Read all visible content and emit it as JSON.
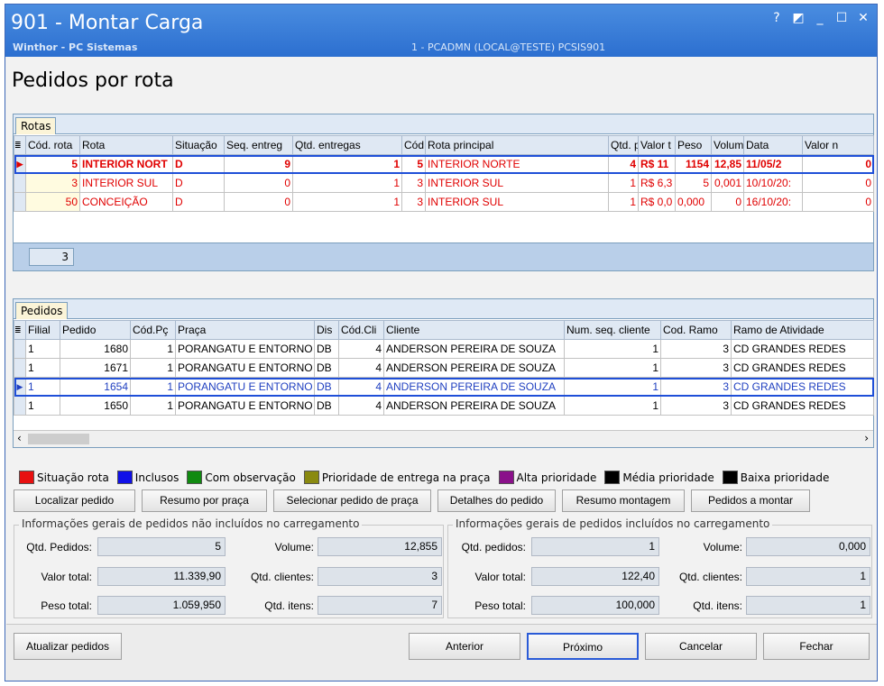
{
  "window": {
    "title": "901 - Montar Carga",
    "subtitle": "Winthor - PC Sistemas",
    "session": "1 - PCADMN (LOCAL@TESTE)   PCSIS901",
    "icons": [
      "help-icon",
      "restore-icon",
      "minimize-icon",
      "maximize-icon",
      "close-icon"
    ]
  },
  "page": {
    "heading": "Pedidos por rota"
  },
  "rotas": {
    "tab_label": "Rotas",
    "columns": [
      "Cód. rota",
      "Rota",
      "Situação",
      "Seq. entreg",
      "Qtd. entregas",
      "Cód",
      "Rota principal",
      "Qtd. p",
      "Valor t",
      "Peso",
      "Volume",
      "Data",
      "Valor n"
    ],
    "rows": [
      [
        "5",
        "INTERIOR NORT",
        "D",
        "9",
        "1",
        "5",
        "INTERIOR NORTE",
        "4",
        "R$ 11",
        "1154",
        "12,85",
        "11/05/2",
        "0"
      ],
      [
        "3",
        "INTERIOR SUL",
        "D",
        "0",
        "1",
        "3",
        "INTERIOR SUL",
        "1",
        "R$ 6,3",
        "5",
        "0,001",
        "10/10/20:",
        "0"
      ],
      [
        "50",
        "CONCEIÇÃO",
        "D",
        "0",
        "1",
        "3",
        "INTERIOR SUL",
        "1",
        "R$ 0,0",
        "0,000",
        "0",
        "16/10/20:",
        "0"
      ]
    ],
    "summary_count": "3"
  },
  "pedidos": {
    "tab_label": "Pedidos",
    "columns": [
      "Filial",
      "Pedido",
      "Cód.Pç",
      "Praça",
      "Dis",
      "Cód.Cli",
      "Cliente",
      "Num. seq. cliente",
      "Cod. Ramo",
      "Ramo de Atividade"
    ],
    "rows": [
      [
        "1",
        "1680",
        "1",
        "PORANGATU E ENTORNO",
        "DB",
        "4",
        "ANDERSON PEREIRA DE SOUZA",
        "1",
        "3",
        "CD GRANDES REDES"
      ],
      [
        "1",
        "1671",
        "1",
        "PORANGATU E ENTORNO",
        "DB",
        "4",
        "ANDERSON PEREIRA DE SOUZA",
        "1",
        "3",
        "CD GRANDES REDES"
      ],
      [
        "1",
        "1654",
        "1",
        "PORANGATU E ENTORNO",
        "DB",
        "4",
        "ANDERSON PEREIRA DE SOUZA",
        "1",
        "3",
        "CD GRANDES REDES"
      ],
      [
        "1",
        "1650",
        "1",
        "PORANGATU E ENTORNO",
        "DB",
        "4",
        "ANDERSON PEREIRA DE SOUZA",
        "1",
        "3",
        "CD GRANDES REDES"
      ]
    ]
  },
  "legend": [
    {
      "label": "Situação rota",
      "color": "#e81010"
    },
    {
      "label": "Inclusos",
      "color": "#1010e8"
    },
    {
      "label": "Com observação",
      "color": "#108a10"
    },
    {
      "label": "Prioridade de entrega na praça",
      "color": "#8a8a10"
    },
    {
      "label": "Alta prioridade",
      "color": "#8a108a"
    },
    {
      "label": "Média prioridade",
      "color": "#000000"
    },
    {
      "label": "Baixa prioridade",
      "color": "#000000"
    }
  ],
  "actions": {
    "localizar": "Localizar pedido",
    "resumo_praca": "Resumo por praça",
    "selecionar": "Selecionar pedido de praça",
    "detalhes": "Detalhes do pedido",
    "resumo_montagem": "Resumo montagem",
    "pedidos_montar": "Pedidos a montar"
  },
  "nao_incluidos": {
    "title": "Informações gerais de pedidos não incluídos no carregamento",
    "qtd_pedidos_label": "Qtd. Pedidos:",
    "qtd_pedidos": "5",
    "volume_label": "Volume:",
    "volume": "12,855",
    "valor_total_label": "Valor total:",
    "valor_total": "11.339,90",
    "qtd_clientes_label": "Qtd. clientes:",
    "qtd_clientes": "3",
    "peso_total_label": "Peso total:",
    "peso_total": "1.059,950",
    "qtd_itens_label": "Qtd. itens:",
    "qtd_itens": "7"
  },
  "incluidos": {
    "title": "Informações gerais de pedidos incluídos no carregamento",
    "qtd_pedidos_label": "Qtd. pedidos:",
    "qtd_pedidos": "1",
    "volume_label": "Volume:",
    "volume": "0,000",
    "valor_total_label": "Valor total:",
    "valor_total": "122,40",
    "qtd_clientes_label": "Qtd. clientes:",
    "qtd_clientes": "1",
    "peso_total_label": "Peso total:",
    "peso_total": "100,000",
    "qtd_itens_label": "Qtd. itens:",
    "qtd_itens": "1"
  },
  "footer": {
    "atualizar": "Atualizar pedidos",
    "anterior": "Anterior",
    "proximo": "Próximo",
    "cancelar": "Cancelar",
    "fechar": "Fechar"
  }
}
